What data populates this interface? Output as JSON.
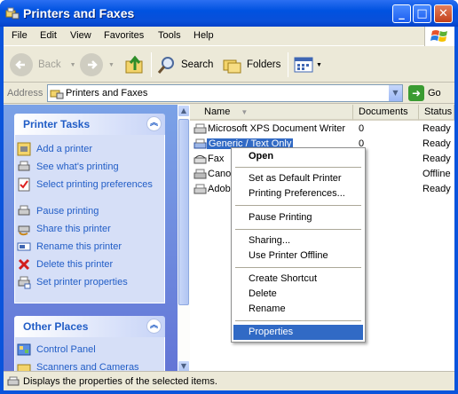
{
  "window": {
    "title": "Printers and Faxes",
    "min": "_",
    "max": "□",
    "close": "✕"
  },
  "menu": [
    "File",
    "Edit",
    "View",
    "Favorites",
    "Tools",
    "Help"
  ],
  "toolbar": {
    "back": "Back",
    "forward": "",
    "search": "Search",
    "folders": "Folders"
  },
  "address": {
    "label": "Address",
    "value": "Printers and Faxes",
    "go": "Go"
  },
  "tasks": {
    "title": "Printer Tasks",
    "items": [
      "Add a printer",
      "See what's printing",
      "Select printing preferences",
      "Pause printing",
      "Share this printer",
      "Rename this printer",
      "Delete this printer",
      "Set printer properties"
    ]
  },
  "places": {
    "title": "Other Places",
    "items": [
      "Control Panel",
      "Scanners and Cameras"
    ]
  },
  "columns": {
    "name": "Name",
    "documents": "Documents",
    "status": "Status"
  },
  "printers": [
    {
      "name": "Microsoft XPS Document Writer",
      "docs": "0",
      "status": "Ready"
    },
    {
      "name": "Generic / Text Only",
      "docs": "0",
      "status": "Ready"
    },
    {
      "name": "Fax",
      "docs": "",
      "status": "Ready"
    },
    {
      "name": "Cano",
      "docs": "",
      "status": "Offline"
    },
    {
      "name": "Adob",
      "docs": "",
      "status": "Ready"
    }
  ],
  "context_menu": [
    "Open",
    "Set as Default Printer",
    "Printing Preferences...",
    "Pause Printing",
    "Sharing...",
    "Use Printer Offline",
    "Create Shortcut",
    "Delete",
    "Rename",
    "Properties"
  ],
  "status": "Displays the properties of the selected items.",
  "colors": {
    "title": "#0a54dc",
    "taskpane": "#6f8ee0",
    "link": "#215dc6",
    "highlight": "#316ac5"
  }
}
